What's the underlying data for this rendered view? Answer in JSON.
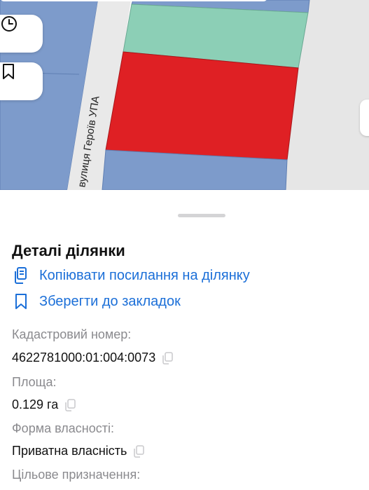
{
  "map": {
    "street_label": "вулиця Героїв УПА",
    "colors": {
      "background": "#e6e6e6",
      "residential_parcel": "#7d9bcb",
      "green_parcel": "#8ccfb6",
      "selected_parcel": "#df2024",
      "road": "#e9e9e9"
    },
    "controls": [
      {
        "name": "history",
        "icon": "clock-icon"
      },
      {
        "name": "bookmarks",
        "icon": "bookmark-icon"
      }
    ]
  },
  "sheet": {
    "title": "Деталі ділянки",
    "actions": {
      "copy_link": {
        "label": "Копіювати посилання на ділянку",
        "icon": "copy-icon"
      },
      "save_bookmark": {
        "label": "Зберегти до закладок",
        "icon": "bookmark-icon"
      }
    },
    "fields": {
      "cadastral_label": "Кадастровий номер:",
      "cadastral_value": "4622781000:01:004:0073",
      "area_label": "Площа:",
      "area_value": "0.129 га",
      "ownership_label": "Форма власності:",
      "ownership_value": "Приватна власність",
      "purpose_label": "Цільове призначення:"
    },
    "accent_color": "#1b6fd8"
  }
}
